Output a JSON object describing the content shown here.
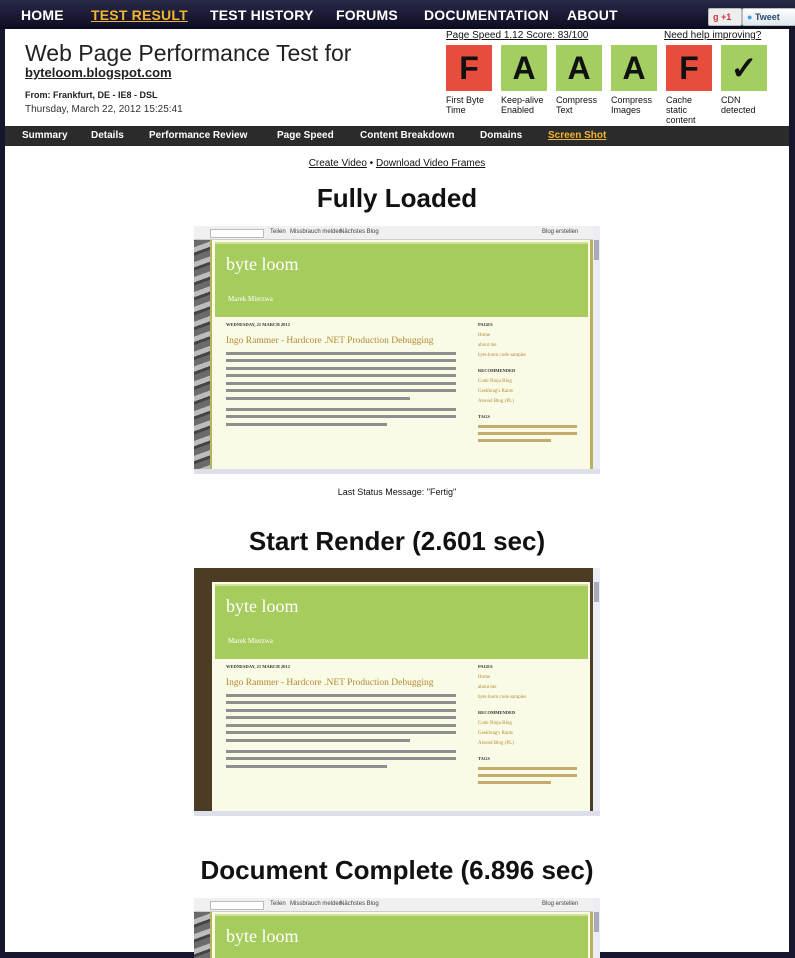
{
  "topnav": {
    "home": "HOME",
    "test_result": "TEST RESULT",
    "test_history": "TEST HISTORY",
    "forums": "FORUMS",
    "documentation": "DOCUMENTATION",
    "about": "ABOUT"
  },
  "social": {
    "gplus": "+1",
    "tweet": "Tweet"
  },
  "header": {
    "title": "Web Page Performance Test for",
    "url": "byteloom.blogspot.com",
    "from": "From: Frankfurt, DE - IE8 - DSL",
    "timestamp": "Thursday, March 22, 2012 15:25:41",
    "page_speed": "Page Speed 1.12 Score: 83/100",
    "help_link": "Need help improving?"
  },
  "grades": [
    {
      "grade": "F",
      "label": "First Byte Time",
      "status": "fail"
    },
    {
      "grade": "A",
      "label": "Keep-alive Enabled",
      "status": "pass"
    },
    {
      "grade": "A",
      "label": "Compress Text",
      "status": "pass"
    },
    {
      "grade": "A",
      "label": "Compress Images",
      "status": "pass"
    },
    {
      "grade": "F",
      "label": "Cache static content",
      "status": "fail"
    },
    {
      "grade": "✓",
      "label": "CDN detected",
      "status": "pass"
    }
  ],
  "subnav": {
    "summary": "Summary",
    "details": "Details",
    "performance_review": "Performance Review",
    "page_speed": "Page Speed",
    "content_breakdown": "Content Breakdown",
    "domains": "Domains",
    "screen_shot": "Screen Shot"
  },
  "links": {
    "create_video": "Create Video",
    "separator": "•",
    "download_frames": "Download Video Frames"
  },
  "sections": {
    "fully_loaded": "Fully Loaded",
    "last_status": "Last Status Message: \"Fertig\"",
    "start_render": "Start Render (2.601 sec)",
    "document_complete": "Document Complete (6.896 sec)"
  },
  "blog": {
    "toolbar_items": [
      "Teilen",
      "Missbrauch melden",
      "Nächstes Blog"
    ],
    "toolbar_right": "Blog erstellen",
    "title": "byte loom",
    "author": "Marek Mierzwa",
    "date": "WEDNESDAY, 21 MARCH 2012",
    "post_title": "Ingo Rammer - Hardcore .NET Production Debugging",
    "sidebar_pages_heading": "PAGES",
    "sidebar_pages": [
      "Home",
      "about me",
      "byte.loom code samples"
    ],
    "sidebar_recommended_heading": "RECOMMENDED",
    "sidebar_recommended": [
      "Code Ninja Blog",
      "Geekbrag's Rants",
      "Arsend Blog (PL)"
    ],
    "sidebar_tags_heading": "TAGS"
  },
  "colors": {
    "fail": "#e74c3c",
    "pass": "#a3cf62",
    "nav_active": "#f2b531",
    "banner": "#a5cc5c"
  }
}
